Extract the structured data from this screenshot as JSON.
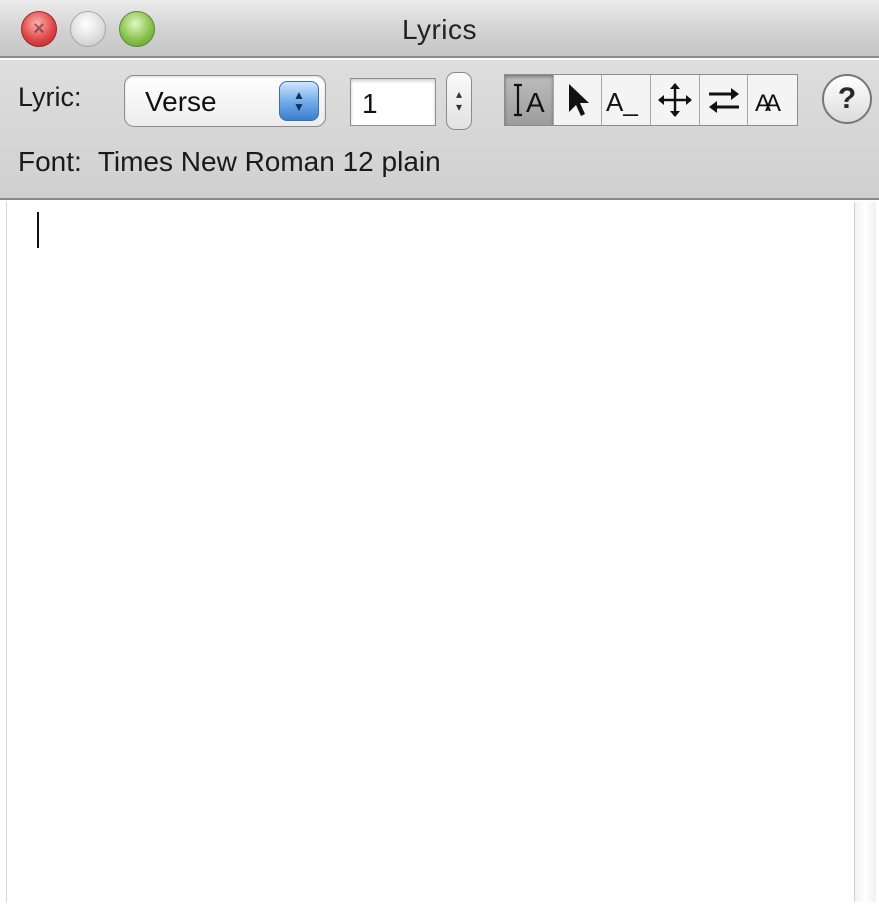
{
  "window": {
    "title": "Lyrics",
    "traffic_lights": [
      "close",
      "minimize",
      "zoom"
    ]
  },
  "toolbar": {
    "lyric_label": "Lyric:",
    "lyric_type": {
      "selected": "Verse"
    },
    "verse_number": "1",
    "tools": [
      {
        "name": "text-insert-tool",
        "icon": "text-cursor-icon",
        "glyph": "A",
        "active": true
      },
      {
        "name": "select-tool",
        "icon": "arrow-pointer-icon",
        "active": false
      },
      {
        "name": "extend-tool",
        "icon": "underscore-a-icon",
        "glyph": "A_",
        "active": false
      },
      {
        "name": "move-tool",
        "icon": "move-arrows-icon",
        "active": false
      },
      {
        "name": "swap-tool",
        "icon": "swap-arrows-icon",
        "active": false
      },
      {
        "name": "kerning-tool",
        "icon": "kerning-icon",
        "glyph": "AA",
        "active": false
      }
    ],
    "help_label": "?"
  },
  "font_row": {
    "label": "Font:",
    "value": "Times New Roman 12 plain"
  },
  "lyrics_editor": {
    "text": ""
  },
  "colors": {
    "close": "#e04848",
    "zoom": "#88c34c",
    "select_arrows": "#3c7ed0"
  }
}
